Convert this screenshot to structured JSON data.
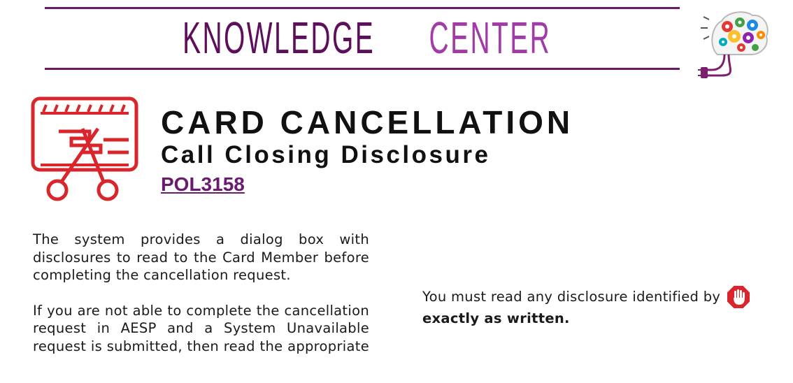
{
  "banner": {
    "word1": "KNOWLEDGE",
    "word2": "CENTER"
  },
  "colors": {
    "accent": "#6a1b68",
    "icon_red": "#d9262c",
    "link": "#6b1a6f"
  },
  "icons": {
    "logo": "brain-gears-icon",
    "card": "card-cut-icon",
    "stop": "stop-hand-icon"
  },
  "header": {
    "title": "CARD CANCELLATION",
    "subtitle": "Call Closing Disclosure",
    "doc_id": "POL3158"
  },
  "body": {
    "p1": "The system provides a dialog box with disclosures to read to the Card Member before completing the cancellation request.",
    "p2": "If you are not able to complete the cancellation request in AESP and a System Unavailable request is submitted, then read the appropriate disclosure to your Card Member.",
    "p3_lead": "You must read any disclosure identified by",
    "p3_bold": "exactly as written."
  }
}
